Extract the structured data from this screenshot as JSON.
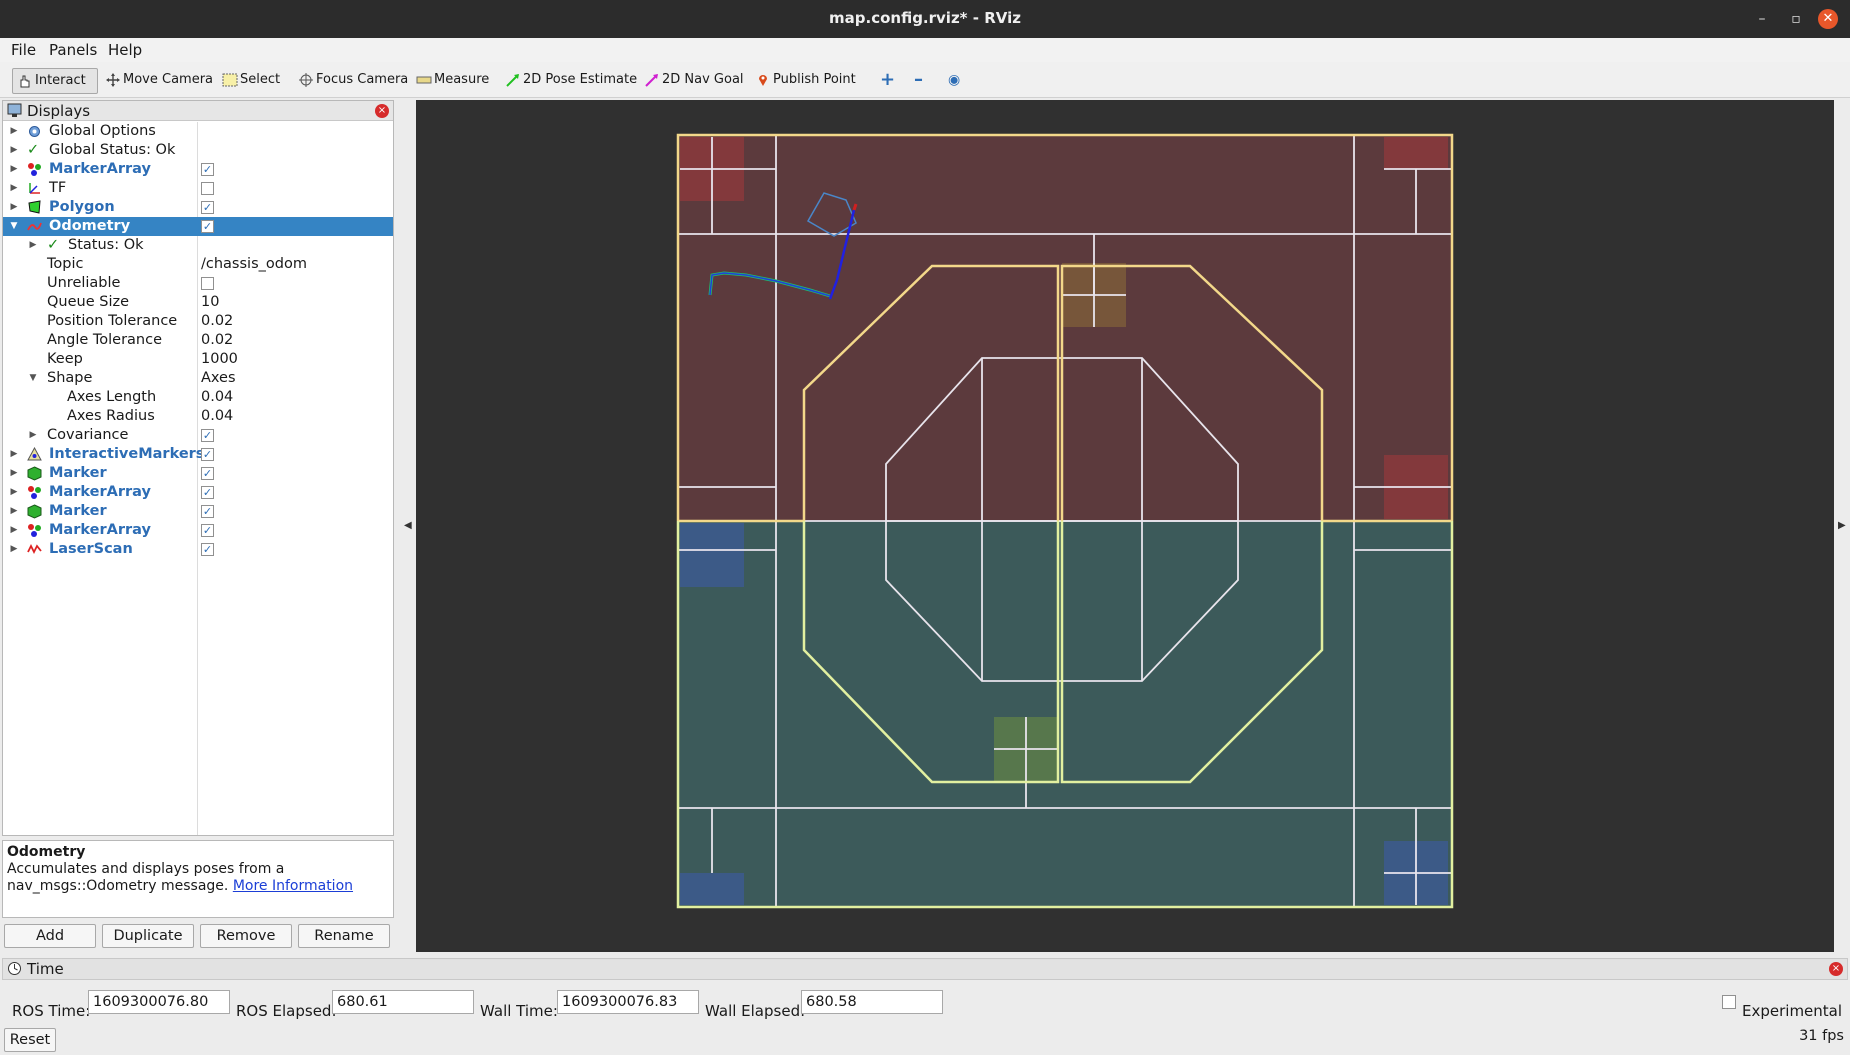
{
  "window": {
    "title": "map.config.rviz* - RViz",
    "minimize": "–",
    "restore": "▫",
    "close": "✕"
  },
  "menu": {
    "file": "File",
    "panels": "Panels",
    "help": "Help"
  },
  "toolbar": {
    "interact": "Interact",
    "move_camera": "Move Camera",
    "select": "Select",
    "focus_camera": "Focus Camera",
    "measure": "Measure",
    "pose_estimate": "2D Pose Estimate",
    "nav_goal": "2D Nav Goal",
    "publish_point": "Publish Point",
    "add_tool": "+",
    "remove_tool": "–",
    "view": "◉"
  },
  "displays": {
    "title": "Displays",
    "close": "×",
    "rows": {
      "global_options": "Global Options",
      "global_status": "Global Status: Ok",
      "marker_array_1": "MarkerArray",
      "tf": "TF",
      "polygon": "Polygon",
      "odometry": "Odometry",
      "status": "Status: Ok",
      "topic_label": "Topic",
      "topic_value": "/chassis_odom",
      "unreliable_label": "Unreliable",
      "queue_label": "Queue Size",
      "queue_value": "10",
      "pos_tol_label": "Position Tolerance",
      "pos_tol_value": "0.02",
      "ang_tol_label": "Angle Tolerance",
      "ang_tol_value": "0.02",
      "keep_label": "Keep",
      "keep_value": "1000",
      "shape_label": "Shape",
      "shape_value": "Axes",
      "axes_length_label": "Axes Length",
      "axes_length_value": "0.04",
      "axes_radius_label": "Axes Radius",
      "axes_radius_value": "0.04",
      "covariance_label": "Covariance",
      "interactive_markers": "InteractiveMarkers",
      "marker_1": "Marker",
      "marker_array_2": "MarkerArray",
      "marker_2": "Marker",
      "marker_array_3": "MarkerArray",
      "laser_scan": "LaserScan"
    },
    "check": "✓"
  },
  "description": {
    "title": "Odometry",
    "text": "Accumulates and displays poses from a nav_msgs::Odometry message.",
    "link": "More Information"
  },
  "buttons": {
    "add": "Add",
    "duplicate": "Duplicate",
    "remove": "Remove",
    "rename": "Rename"
  },
  "time": {
    "title": "Time",
    "close": "×",
    "ros_time_label": "ROS Time:",
    "ros_time_value": "1609300076.80",
    "ros_elapsed_label": "ROS Elapsed:",
    "ros_elapsed_value": "680.61",
    "wall_time_label": "Wall Time:",
    "wall_time_value": "1609300076.83",
    "wall_elapsed_label": "Wall Elapsed:",
    "wall_elapsed_value": "680.58",
    "experimental_label": "Experimental",
    "reset": "Reset",
    "fps": "31 fps"
  },
  "colors": {
    "selection": "#3584c4",
    "viewport_bg": "#303030",
    "map_red": "#5c3a3d",
    "map_teal": "#3c5a5a",
    "outline_yellow": "#f3d88a",
    "outline_light": "#e2f0a0"
  }
}
